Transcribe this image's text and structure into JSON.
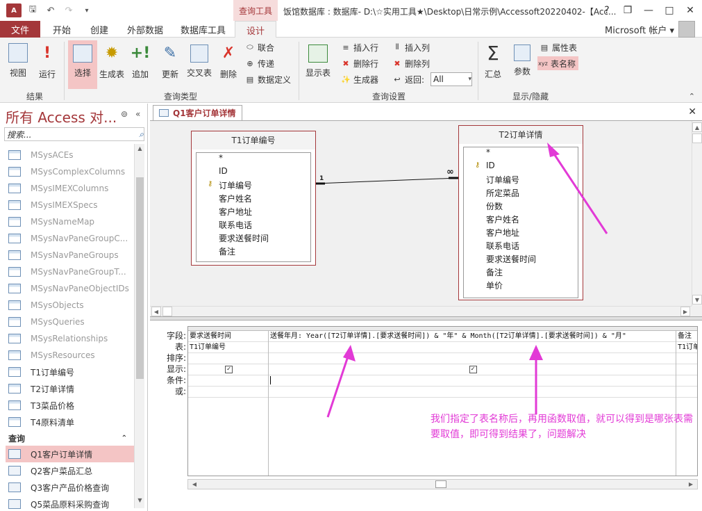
{
  "titlebar": {
    "app_icon": "A",
    "qat_icons": [
      "save-icon",
      "undo-icon",
      "redo-icon",
      "customize-icon"
    ],
    "context_tab": "查询工具",
    "title": "饭馆数据库 : 数据库- D:\\☆实用工具★\\Desktop\\日常示例\\Accessoft20220402-【Acc...",
    "help": "?",
    "controls": [
      "restore",
      "minimize",
      "maximize",
      "close"
    ]
  },
  "ribbon_tabs": {
    "file": "文件",
    "tabs": [
      "开始",
      "创建",
      "外部数据",
      "数据库工具",
      "设计"
    ],
    "active": "设计",
    "account": "Microsoft 帐户"
  },
  "ribbon": {
    "results": {
      "label": "结果",
      "view": "视图",
      "run": "运行"
    },
    "query_type": {
      "label": "查询类型",
      "select": "选择",
      "make_table": "生成表",
      "append": "追加",
      "update": "更新",
      "crosstab": "交叉表",
      "delete": "删除",
      "union": "联合",
      "pass_through": "传递",
      "data_definition": "数据定义"
    },
    "query_setup": {
      "label": "查询设置",
      "show_table": "显示表",
      "insert_rows": "插入行",
      "delete_rows": "删除行",
      "builder": "生成器",
      "insert_columns": "插入列",
      "delete_columns": "删除列",
      "return_label": "返回:",
      "return_value": "All"
    },
    "show_hide": {
      "label": "显示/隐藏",
      "totals": "汇总",
      "parameters": "参数",
      "property_sheet": "属性表",
      "table_names": "表名称"
    }
  },
  "nav": {
    "title": "所有 Access 对...",
    "search_placeholder": "搜索...",
    "items": [
      {
        "label": "MSysACEs",
        "type": "table",
        "system": true
      },
      {
        "label": "MSysComplexColumns",
        "type": "table",
        "system": true
      },
      {
        "label": "MSysIMEXColumns",
        "type": "table",
        "system": true
      },
      {
        "label": "MSysIMEXSpecs",
        "type": "table",
        "system": true
      },
      {
        "label": "MSysNameMap",
        "type": "table",
        "system": true
      },
      {
        "label": "MSysNavPaneGroupC...",
        "type": "table",
        "system": true
      },
      {
        "label": "MSysNavPaneGroups",
        "type": "table",
        "system": true
      },
      {
        "label": "MSysNavPaneGroupT...",
        "type": "table",
        "system": true
      },
      {
        "label": "MSysNavPaneObjectIDs",
        "type": "table",
        "system": true
      },
      {
        "label": "MSysObjects",
        "type": "table",
        "system": true
      },
      {
        "label": "MSysQueries",
        "type": "table",
        "system": true
      },
      {
        "label": "MSysRelationships",
        "type": "table",
        "system": true
      },
      {
        "label": "MSysResources",
        "type": "table",
        "system": true
      },
      {
        "label": "T1订单编号",
        "type": "table",
        "system": false
      },
      {
        "label": "T2订单详情",
        "type": "table",
        "system": false
      },
      {
        "label": "T3菜品价格",
        "type": "table",
        "system": false
      },
      {
        "label": "T4原料清单",
        "type": "table",
        "system": false
      }
    ],
    "query_category": "查询",
    "queries": [
      {
        "label": "Q1客户订单详情",
        "selected": true
      },
      {
        "label": "Q2客户菜品汇总",
        "selected": false
      },
      {
        "label": "Q3客户产品价格查询",
        "selected": false
      },
      {
        "label": "Q5菜品原料采购查询",
        "selected": false
      }
    ]
  },
  "document": {
    "tab_label": "Q1客户订单详情",
    "table1": {
      "name": "T1订单编号",
      "fields": [
        {
          "name": "*",
          "key": false
        },
        {
          "name": "ID",
          "key": false
        },
        {
          "name": "订单编号",
          "key": true
        },
        {
          "name": "客户姓名",
          "key": false
        },
        {
          "name": "客户地址",
          "key": false
        },
        {
          "name": "联系电话",
          "key": false
        },
        {
          "name": "要求送餐时间",
          "key": false
        },
        {
          "name": "备注",
          "key": false
        }
      ]
    },
    "table2": {
      "name": "T2订单详情",
      "fields": [
        {
          "name": "*",
          "key": false
        },
        {
          "name": "ID",
          "key": true
        },
        {
          "name": "订单编号",
          "key": false
        },
        {
          "name": "所定菜品",
          "key": false
        },
        {
          "name": "份数",
          "key": false
        },
        {
          "name": "客户姓名",
          "key": false
        },
        {
          "name": "客户地址",
          "key": false
        },
        {
          "name": "联系电话",
          "key": false
        },
        {
          "name": "要求送餐时间",
          "key": false
        },
        {
          "name": "备注",
          "key": false
        },
        {
          "name": "单价",
          "key": false
        }
      ]
    },
    "join": {
      "left": "1",
      "right": "∞"
    },
    "grid": {
      "row_labels": [
        "字段:",
        "表:",
        "排序:",
        "显示:",
        "条件:",
        "或:"
      ],
      "columns": [
        {
          "field": "要求送餐时间",
          "table": "T1订单编号",
          "show": true
        },
        {
          "field": "送餐年月: Year([T2订单详情].[要求送餐时间]) & \"年\" & Month([T2订单详情].[要求送餐时间]) & \"月\"",
          "table": "",
          "show": true
        },
        {
          "field": "备注",
          "table": "T1订单",
          "show": false
        }
      ]
    }
  },
  "annotation": {
    "text": "我们指定了表名称后，再用函数取值，就可以得到是哪张表需要取值，即可得到结果了，问题解决",
    "color": "#e23ad6"
  },
  "colors": {
    "accent": "#a4373a",
    "selected": "#f4c5c5",
    "annotation": "#e23ad6"
  }
}
